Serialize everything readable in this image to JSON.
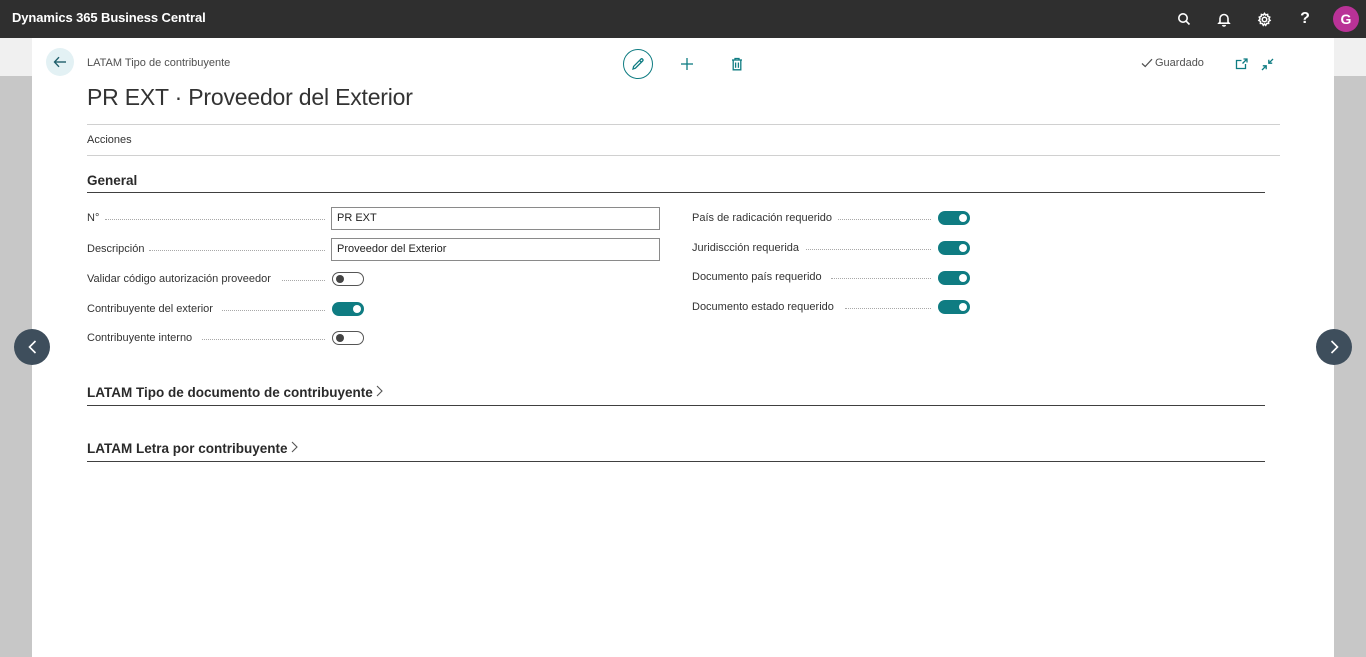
{
  "app": {
    "title": "Dynamics 365 Business Central",
    "user_initial": "G"
  },
  "page": {
    "breadcrumb": "LATAM Tipo de contribuyente",
    "title": "PR EXT · Proveedor del Exterior",
    "saved_label": "Guardado",
    "actions_label": "Acciones"
  },
  "general": {
    "title": "General",
    "no_label": "N°",
    "no_value": "PR EXT",
    "descripcion_label": "Descripción",
    "descripcion_value": "Proveedor del Exterior",
    "validar_label": "Validar código autorización proveedor",
    "validar_on": false,
    "contrib_exterior_label": "Contribuyente del exterior",
    "contrib_exterior_on": true,
    "contrib_interno_label": "Contribuyente interno",
    "contrib_interno_on": false,
    "pais_radicacion_label": "País de radicación requerido",
    "pais_radicacion_on": true,
    "jurisdiccion_label": "Juridiscción requerida",
    "jurisdiccion_on": true,
    "doc_pais_label": "Documento país requerido",
    "doc_pais_on": true,
    "doc_estado_label": "Documento estado requerido",
    "doc_estado_on": true
  },
  "sections": {
    "tipo_documento": "LATAM Tipo de documento de contribuyente",
    "letra": "LATAM Letra por contribuyente"
  },
  "colors": {
    "accent": "#0f7c82",
    "topbar": "#2f2f2f",
    "avatar": "#b93297",
    "nav_arrow": "#3e4e5c"
  },
  "icons": [
    "search-icon",
    "bell-icon",
    "gear-icon",
    "help-icon",
    "back-arrow-icon",
    "edit-icon",
    "plus-icon",
    "delete-icon",
    "checkmark-icon",
    "open-new-window-icon",
    "collapse-icon",
    "chevron-right-icon",
    "chevron-left-icon"
  ]
}
